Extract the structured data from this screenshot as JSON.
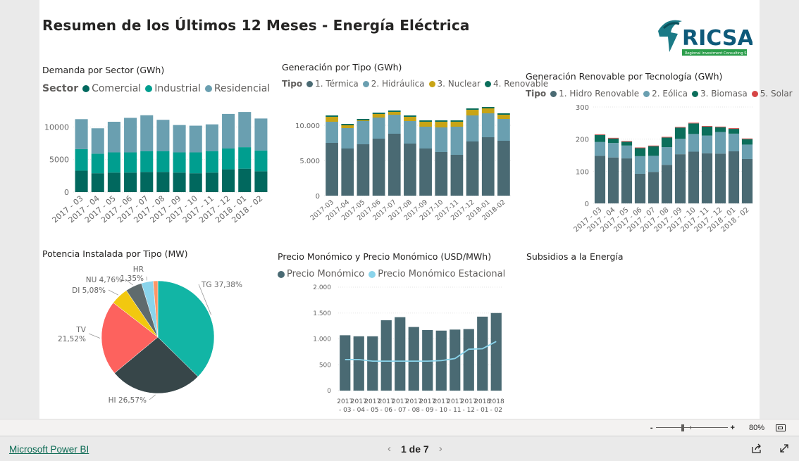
{
  "report": {
    "title": "Resumen de los Últimos 12 Meses - Energía Eléctrica",
    "logo_text": "RICSA",
    "logo_sub": "Regional Investment Consulting S.A."
  },
  "colors": {
    "c1": "#01685e",
    "c2": "#009e8f",
    "c3": "#6a9fb0",
    "termica": "#4a6a73",
    "hidraulica": "#6a9fb0",
    "nuclear": "#c8a415",
    "renovable": "#0b6e5b",
    "pie_tg": "#12b5a5",
    "pie_hi": "#374649",
    "pie_tv": "#fd625e",
    "pie_di": "#f2c80f",
    "pie_nu": "#5f6b6d",
    "pie_hr": "#8ad4eb",
    "pie_other": "#fe9666",
    "precio": "#4a6a73",
    "estacional": "#8ad4eb"
  },
  "chart_data": [
    {
      "type": "bar",
      "id": "demanda",
      "title": "Demanda por Sector (GWh)",
      "legend_title": "Sector",
      "categories": [
        "2017 - 03",
        "2017 - 04",
        "2017 - 05",
        "2017 - 06",
        "2017 - 07",
        "2017 - 08",
        "2017 - 09",
        "2017 - 10",
        "2017 - 11",
        "2017 - 12",
        "2018 - 01",
        "2018 - 02"
      ],
      "series": [
        {
          "name": "Comercial",
          "values": [
            3300,
            2900,
            3000,
            3000,
            3100,
            3100,
            3000,
            2900,
            3000,
            3500,
            3600,
            3200
          ]
        },
        {
          "name": "Industrial",
          "values": [
            3300,
            3000,
            3100,
            3100,
            3200,
            3200,
            3100,
            3200,
            3300,
            3200,
            3300,
            3200
          ]
        },
        {
          "name": "Residencial",
          "values": [
            4600,
            3900,
            4700,
            5300,
            5500,
            4800,
            4200,
            4100,
            4100,
            5300,
            5400,
            4900
          ]
        }
      ],
      "yticks": [
        0,
        5000,
        10000
      ],
      "ytick_labels": [
        "0",
        "5000",
        "10000"
      ],
      "ylim": [
        0,
        13500
      ]
    },
    {
      "type": "bar",
      "id": "generacion",
      "title": "Generación por Tipo (GWh)",
      "legend_title": "Tipo",
      "categories": [
        "2017-03",
        "2017-04",
        "2017-05",
        "2017-06",
        "2017-07",
        "2017-08",
        "2017-09",
        "2017-10",
        "2017-11",
        "2017-12",
        "2018-01",
        "2018-02"
      ],
      "series": [
        {
          "name": "1. Térmica",
          "values": [
            7500,
            6700,
            7300,
            8100,
            8800,
            7400,
            6700,
            6200,
            5800,
            7700,
            8300,
            7800
          ]
        },
        {
          "name": "2. Hidráulica",
          "values": [
            3000,
            2900,
            3300,
            3000,
            2700,
            3200,
            3100,
            3500,
            4000,
            3700,
            3400,
            3100
          ]
        },
        {
          "name": "3. Nuclear",
          "values": [
            700,
            400,
            100,
            500,
            400,
            600,
            700,
            800,
            700,
            800,
            700,
            600
          ]
        },
        {
          "name": "4. Renovable",
          "values": [
            200,
            200,
            200,
            200,
            200,
            200,
            200,
            200,
            200,
            200,
            200,
            200
          ]
        }
      ],
      "yticks": [
        0,
        5000,
        10000
      ],
      "ytick_labels": [
        "0",
        "5.000",
        "10.000"
      ],
      "ylim": [
        0,
        13500
      ]
    },
    {
      "type": "bar",
      "id": "renovable",
      "title": "Generación Renovable por Tecnología (GWh)",
      "legend_title": "Tipo",
      "categories": [
        "2017 - 03",
        "2017 - 04",
        "2017 - 05",
        "2017 - 06",
        "2017 - 07",
        "2017 - 08",
        "2017 - 09",
        "2017 - 10",
        "2017 - 11",
        "2017 - 12",
        "2018 - 01",
        "2018 - 02"
      ],
      "series": [
        {
          "name": "1. Hidro Renovable",
          "values": [
            148,
            143,
            140,
            92,
            98,
            120,
            153,
            161,
            156,
            155,
            162,
            138
          ]
        },
        {
          "name": "2. Eólica",
          "values": [
            43,
            45,
            40,
            55,
            50,
            55,
            48,
            55,
            55,
            67,
            55,
            45
          ]
        },
        {
          "name": "3. Biomasa",
          "values": [
            22,
            14,
            12,
            25,
            30,
            30,
            35,
            33,
            28,
            15,
            15,
            17
          ]
        },
        {
          "name": "5. Solar",
          "values": [
            2,
            2,
            2,
            2,
            2,
            2,
            2,
            2,
            2,
            2,
            2,
            2
          ]
        }
      ],
      "yticks": [
        0,
        100,
        200,
        300
      ],
      "ytick_labels": [
        "0",
        "100",
        "200",
        "300"
      ],
      "ylim": [
        0,
        300
      ]
    },
    {
      "type": "pie",
      "id": "potencia",
      "title": "Potencia Instalada por Tipo (MW)",
      "slices": [
        {
          "name": "TG",
          "value": 37.38,
          "label": "TG 37,38%"
        },
        {
          "name": "HI",
          "value": 26.57,
          "label": "HI 26,57%"
        },
        {
          "name": "TV",
          "value": 21.52,
          "label": "TV 21,52%"
        },
        {
          "name": "DI",
          "value": 5.08,
          "label": "DI 5,08%"
        },
        {
          "name": "NU",
          "value": 4.76,
          "label": "NU 4,76%"
        },
        {
          "name": "HR",
          "value": 3.35,
          "label": "HR 1,35%"
        },
        {
          "name": "other",
          "value": 1.34,
          "label": ""
        }
      ]
    },
    {
      "type": "bar",
      "id": "precio",
      "title": "Precio Monómico y Precio Monómico (USD/MWh)",
      "categories": [
        "2017 - 03",
        "2017 - 04",
        "2017 - 05",
        "2017 - 06",
        "2017 - 07",
        "2017 - 08",
        "2017 - 09",
        "2017 - 10",
        "2017 - 11",
        "2017 - 12",
        "2018 - 01",
        "2018 - 02"
      ],
      "series": [
        {
          "name": "Precio Monómico",
          "values": [
            1070,
            1050,
            1050,
            1360,
            1420,
            1230,
            1170,
            1160,
            1180,
            1190,
            1430,
            1500
          ]
        },
        {
          "name": "Precio Monómico Estacional",
          "values": [
            600,
            600,
            570,
            570,
            570,
            570,
            570,
            580,
            620,
            800,
            810,
            950
          ]
        }
      ],
      "yticks": [
        0,
        500,
        1000,
        1500,
        2000
      ],
      "ytick_labels": [
        "0",
        "500",
        "1.000",
        "1.500",
        "2.000"
      ],
      "ylim": [
        0,
        2000
      ]
    }
  ],
  "subsidios": {
    "title": "Subsidios a la Energía"
  },
  "footer": {
    "powerbi_link": "Microsoft Power BI",
    "page_label": "1 de 7",
    "prev": "‹",
    "next": "›",
    "zoom_minus": "-",
    "zoom_plus": "+",
    "zoom_level": "80%"
  }
}
